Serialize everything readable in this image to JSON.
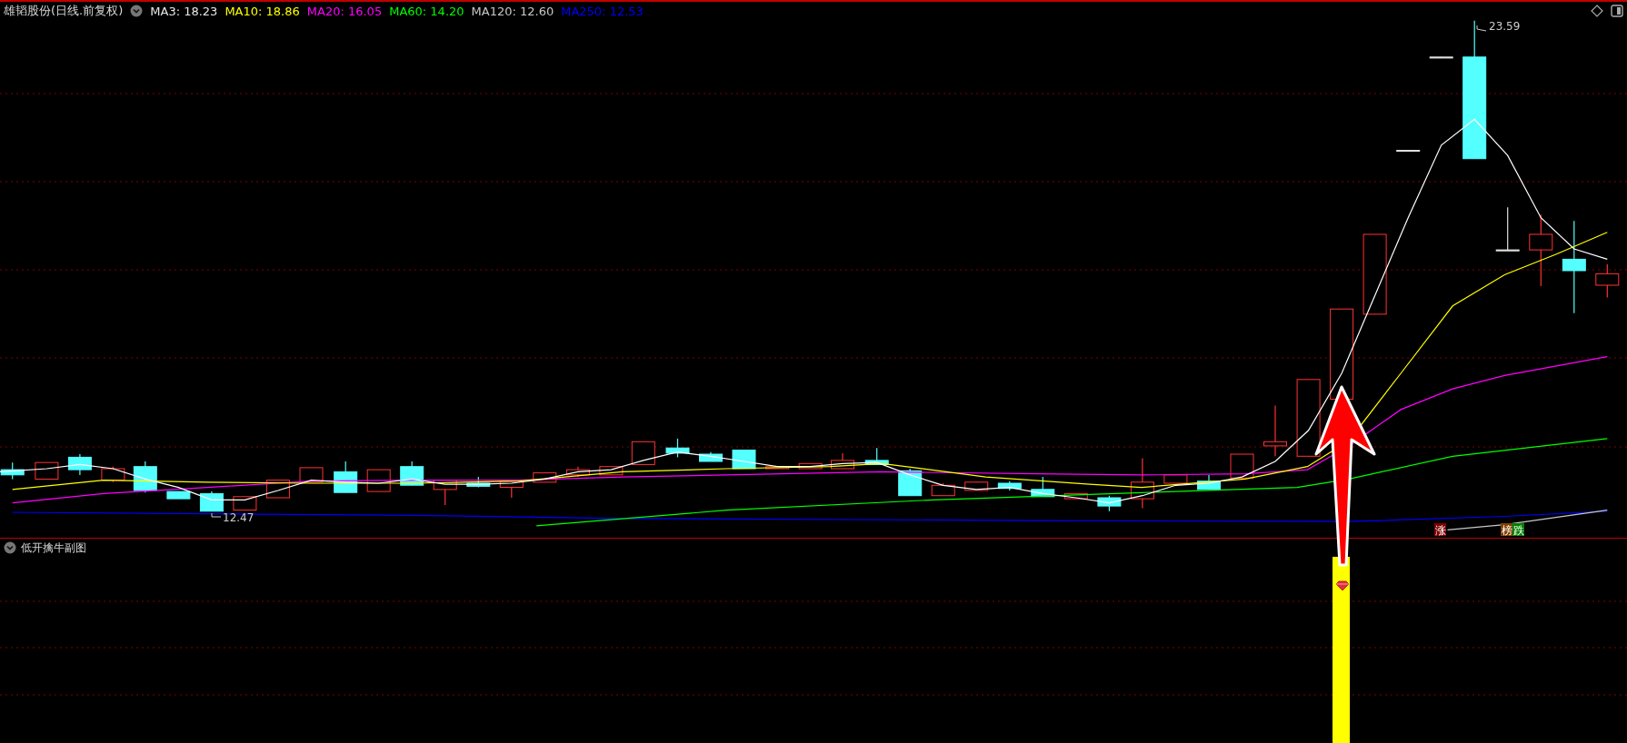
{
  "header": {
    "title": "雄韬股份(日线.前复权)",
    "indicators": [
      {
        "label": "MA3: 18.23",
        "color": "#e6e6e6"
      },
      {
        "label": "MA10: 18.86",
        "color": "#ffff00"
      },
      {
        "label": "MA20: 16.05",
        "color": "#ff00ff"
      },
      {
        "label": "MA60: 14.20",
        "color": "#00ff00"
      },
      {
        "label": "MA120: 12.60",
        "color": "#c8c8c8"
      },
      {
        "label": "MA250: 12.53",
        "color": "#0000ff"
      }
    ]
  },
  "main_chart": {
    "high_label": "23.59",
    "low_label": "12.47"
  },
  "signals": [
    {
      "label": "涨",
      "color": "#800000"
    },
    {
      "label": "榜",
      "color": "#804000"
    },
    {
      "label": "跌",
      "color": "#008000"
    }
  ],
  "sub_chart": {
    "title": "低开擒牛副图"
  }
}
